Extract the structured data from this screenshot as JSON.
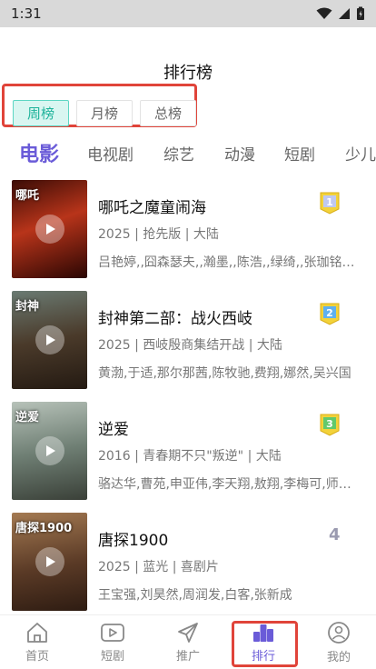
{
  "status_bar": {
    "time": "1:31"
  },
  "page": {
    "title": "排行榜"
  },
  "period_tabs": [
    {
      "label": "周榜",
      "active": true
    },
    {
      "label": "月榜",
      "active": false
    },
    {
      "label": "总榜",
      "active": false
    }
  ],
  "category_tabs": [
    {
      "label": "电影",
      "active": true
    },
    {
      "label": "电视剧",
      "active": false
    },
    {
      "label": "综艺",
      "active": false
    },
    {
      "label": "动漫",
      "active": false
    },
    {
      "label": "短剧",
      "active": false
    },
    {
      "label": "少儿",
      "active": false
    }
  ],
  "rank_items": [
    {
      "rank": "1",
      "title": "哪吒之魔童闹海",
      "meta": "2025 | 抢先版 | 大陆",
      "cast": "吕艳婷,,囧森瑟夫,,瀚墨,,陈浩,,绿绮,,张珈铭,,杨卫",
      "badge_color": "#f3d23a",
      "poster_text": "哪吒"
    },
    {
      "rank": "2",
      "title": "封神第二部：战火西岐",
      "meta": "2025 | 西岐殷商集结开战 | 大陆",
      "cast": "黄渤,于适,那尔那茜,陈牧驰,费翔,娜然,吴兴国",
      "badge_color": "#5fb0ef",
      "poster_text": "封神"
    },
    {
      "rank": "3",
      "title": "逆爱",
      "meta": "2016 | 青春期不只\"叛逆\" | 大陆",
      "cast": "骆达华,曹苑,申亚伟,李天翔,敖翔,李梅可,师小楠",
      "badge_color": "#62c96c",
      "poster_text": "逆爱"
    },
    {
      "rank": "4",
      "title": "唐探1900",
      "meta": "2025 | 蓝光 | 喜剧片",
      "cast": "王宝强,刘昊然,周润发,白客,张新成",
      "badge_color": "",
      "poster_text": "唐探1900"
    }
  ],
  "bottom_nav": [
    {
      "label": "首页",
      "icon": "home-icon",
      "active": false
    },
    {
      "label": "短剧",
      "icon": "video-play-icon",
      "active": false
    },
    {
      "label": "推广",
      "icon": "paper-plane-icon",
      "active": false
    },
    {
      "label": "排行",
      "icon": "ranking-icon",
      "active": true
    },
    {
      "label": "我的",
      "icon": "profile-icon",
      "active": false
    }
  ],
  "colors": {
    "accent": "#6a5bd8",
    "period_active": "#1fb39b",
    "highlight_border": "#e0443a"
  }
}
